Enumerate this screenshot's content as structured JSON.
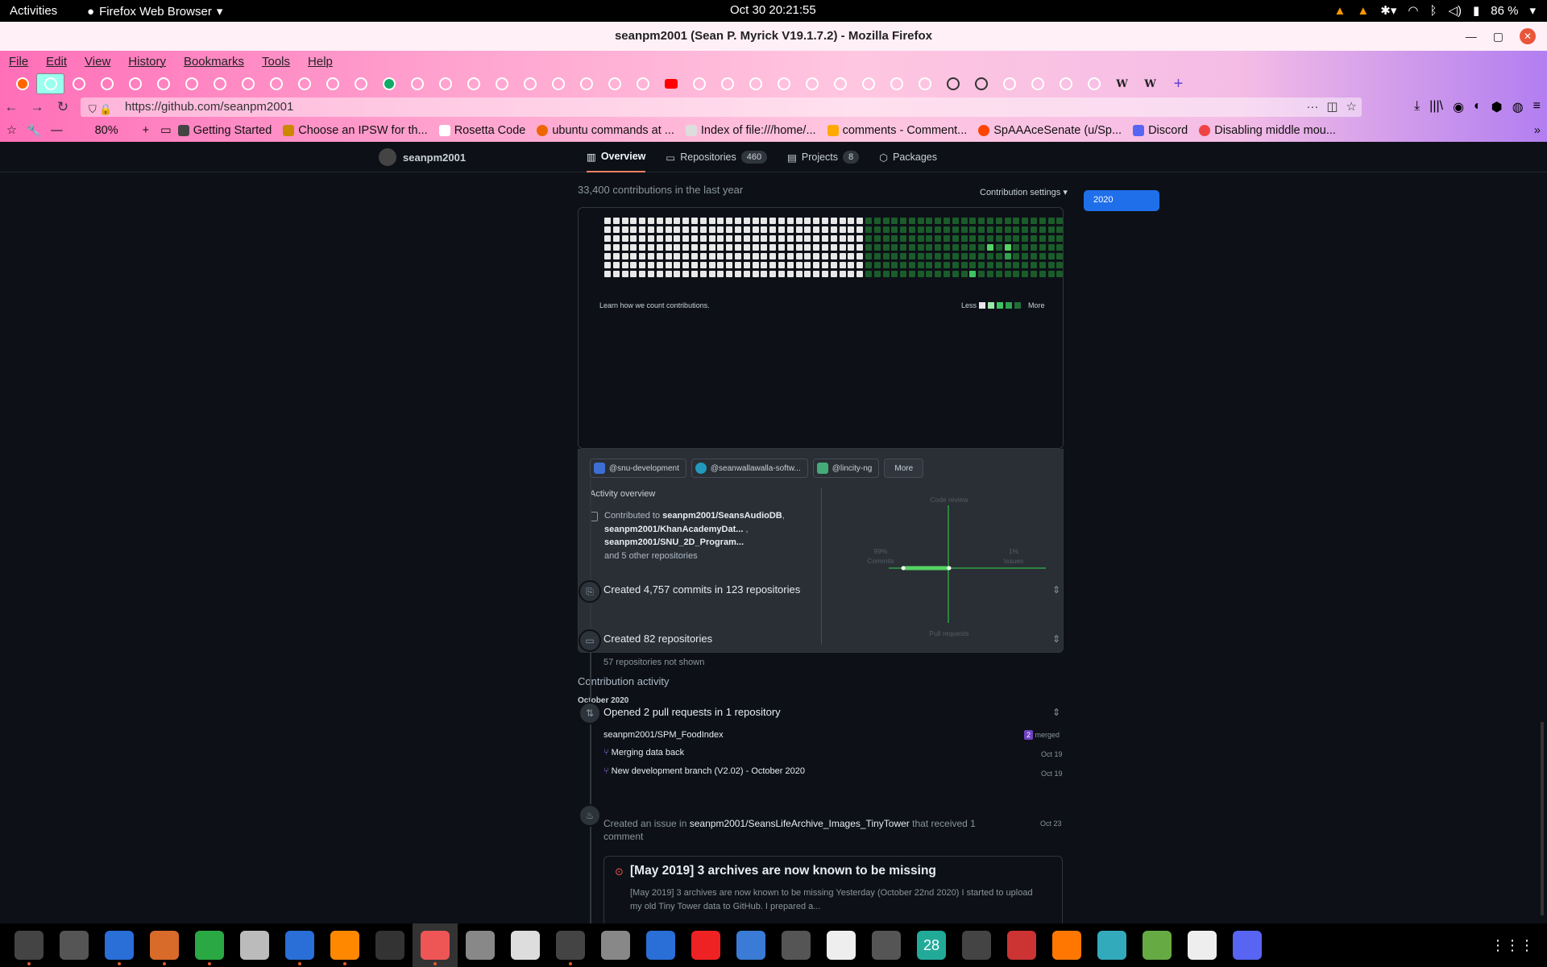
{
  "topbar": {
    "activities": "Activities",
    "app_name": "Firefox Web Browser",
    "clock": "Oct 30  20:21:55",
    "battery": "86 %"
  },
  "window": {
    "title": "seanpm2001 (Sean P. Myrick V19.1.7.2) - Mozilla Firefox"
  },
  "menubar": {
    "items": [
      "File",
      "Edit",
      "View",
      "History",
      "Bookmarks",
      "Tools",
      "Help"
    ]
  },
  "tabs": {
    "icons": [
      "firefox",
      "github",
      "github",
      "github",
      "github",
      "github",
      "github",
      "github",
      "github",
      "github",
      "github",
      "github",
      "github",
      "green",
      "github",
      "github",
      "github",
      "github",
      "github",
      "github",
      "github",
      "github",
      "github",
      "youtube",
      "github",
      "github",
      "github",
      "github",
      "github",
      "github",
      "github",
      "github",
      "github",
      "dark",
      "dark",
      "github",
      "github",
      "github",
      "github",
      "wikipedia",
      "wikipedia"
    ],
    "selected_index": 1
  },
  "navbar": {
    "url": "https://github.com/seanpm2001",
    "zoom": "80%"
  },
  "bookmarks": {
    "items": [
      "Getting Started",
      "Choose an IPSW for th...",
      "Rosetta Code",
      "ubuntu commands at ...",
      "Index of file:///home/...",
      "comments - Comment...",
      "SpAAAceSenate (u/Sp...",
      "Discord",
      "Disabling middle mou..."
    ]
  },
  "profile_nav": {
    "username": "seanpm2001",
    "tabs": [
      {
        "label": "Overview",
        "count": ""
      },
      {
        "label": "Repositories",
        "count": "460"
      },
      {
        "label": "Projects",
        "count": "8"
      },
      {
        "label": "Packages",
        "count": ""
      }
    ]
  },
  "contributions": {
    "title": "33,400 contributions in the last year",
    "settings": "Contribution settings ▾",
    "year": "2020",
    "learn": "Learn how we count contributions.",
    "less": "Less",
    "more": "More"
  },
  "activity_overview": {
    "orgs": [
      "@snu-development",
      "@seanwallawalla-softw...",
      "@lincity-ng"
    ],
    "more": "More",
    "title": "Activity overview",
    "contributed_to": "Contributed to",
    "repo1": "seanpm2001/SeansAudioDB",
    "repo2": "seanpm2001/KhanAcademyDat...",
    "repo3": "seanpm2001/SNU_2D_Program...",
    "other": "and 5 other repositories",
    "axis": {
      "code_review": "Code review",
      "commits_pct": "99%",
      "commits": "Commits",
      "issues_pct": "1%",
      "issues": "Issues",
      "pull_requests": "Pull requests"
    }
  },
  "contribution_activity": {
    "title": "Contribution activity",
    "month": "October 2020",
    "commits": "Created 4,757 commits in 123 repositories",
    "repos": "Created 82 repositories",
    "repos_hidden": "57 repositories not shown",
    "prs": "Opened 2 pull requests in 1 repository",
    "pr_repo": "seanpm2001/SPM_FoodIndex",
    "merged_count": "2",
    "merged": "merged",
    "pr1": "Merging data back",
    "pr1_date": "Oct 19",
    "pr2": "New development branch (V2.02) - October 2020",
    "pr2_date": "Oct 19",
    "issue_line_a": "Created an issue in",
    "issue_repo": "seanpm2001/SeansLifeArchive_Images_TinyTower",
    "issue_line_b": "that received 1",
    "issue_line_c": "comment",
    "issue_date": "Oct 23",
    "issue_title": "[May 2019] 3 archives are now known to be missing",
    "issue_body1": "[May 2019] 3 archives are now known to be missing Yesterday (October 22nd 2020) I started to upload",
    "issue_body2": "my old Tiny Tower data to GitHub. I prepared a..."
  },
  "dock": {
    "apps": [
      "system-monitor",
      "add",
      "writer",
      "impress",
      "calc",
      "files",
      "text-editor",
      "vlc",
      "terminal",
      "firefox",
      "search",
      "viewer",
      "calculator",
      "settings",
      "virtualbox",
      "headphones",
      "tasks",
      "gimp",
      "audio",
      "store",
      "calendar",
      "inkscape",
      "mario",
      "blender",
      "speaker",
      "image",
      "typora",
      "discord"
    ],
    "calendar_day": "28"
  }
}
